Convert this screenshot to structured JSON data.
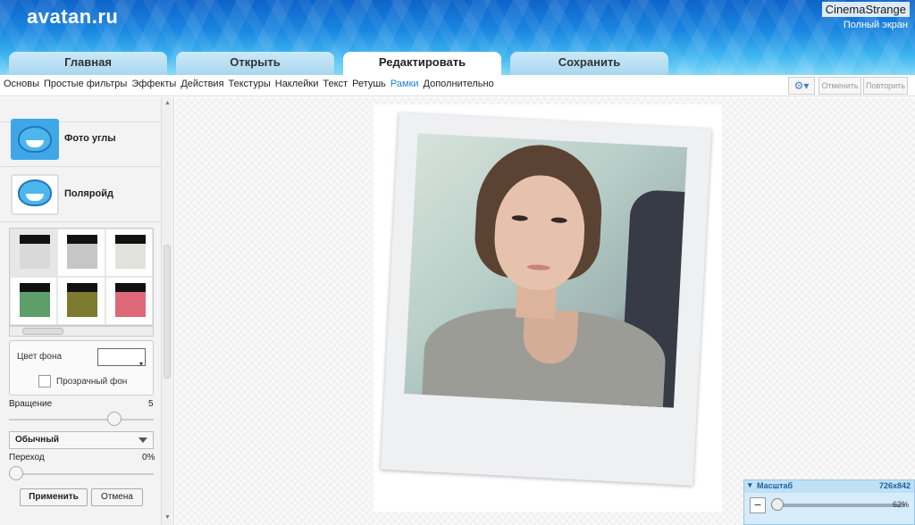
{
  "header": {
    "logo": "avatan.ru",
    "user": "CinemaStrange",
    "fullscreen": "Полный экран"
  },
  "tabs": [
    "Главная",
    "Открыть",
    "Редактировать",
    "Сохранить"
  ],
  "active_tab": "Редактировать",
  "toolbar": {
    "items": [
      "Основы",
      "Простые фильтры",
      "Эффекты",
      "Действия",
      "Текстуры",
      "Наклейки",
      "Текст",
      "Ретушь",
      "Рамки",
      "Дополнительно"
    ],
    "active_item": "Рамки",
    "undo": "Отменить",
    "redo": "Повторить"
  },
  "panel": {
    "effect1": "Фото углы",
    "effect2": "Поляройд",
    "swatch_colors": [
      "#d9d9d9",
      "#c6c6c6",
      "#e2e2dd",
      "#5e9e6b",
      "#7b7a2e",
      "#de6878"
    ],
    "bg_color_label": "Цвет фона",
    "transparent_label": "Прозрачный фон",
    "rotation_label": "Вращение",
    "rotation_value": "5",
    "blend_mode": "Обычный",
    "transition_label": "Переход",
    "transition_value": "0%",
    "apply": "Применить",
    "cancel": "Отмена"
  },
  "zoom": {
    "title": "Масштаб",
    "size": "726x842",
    "percent": "62%"
  }
}
